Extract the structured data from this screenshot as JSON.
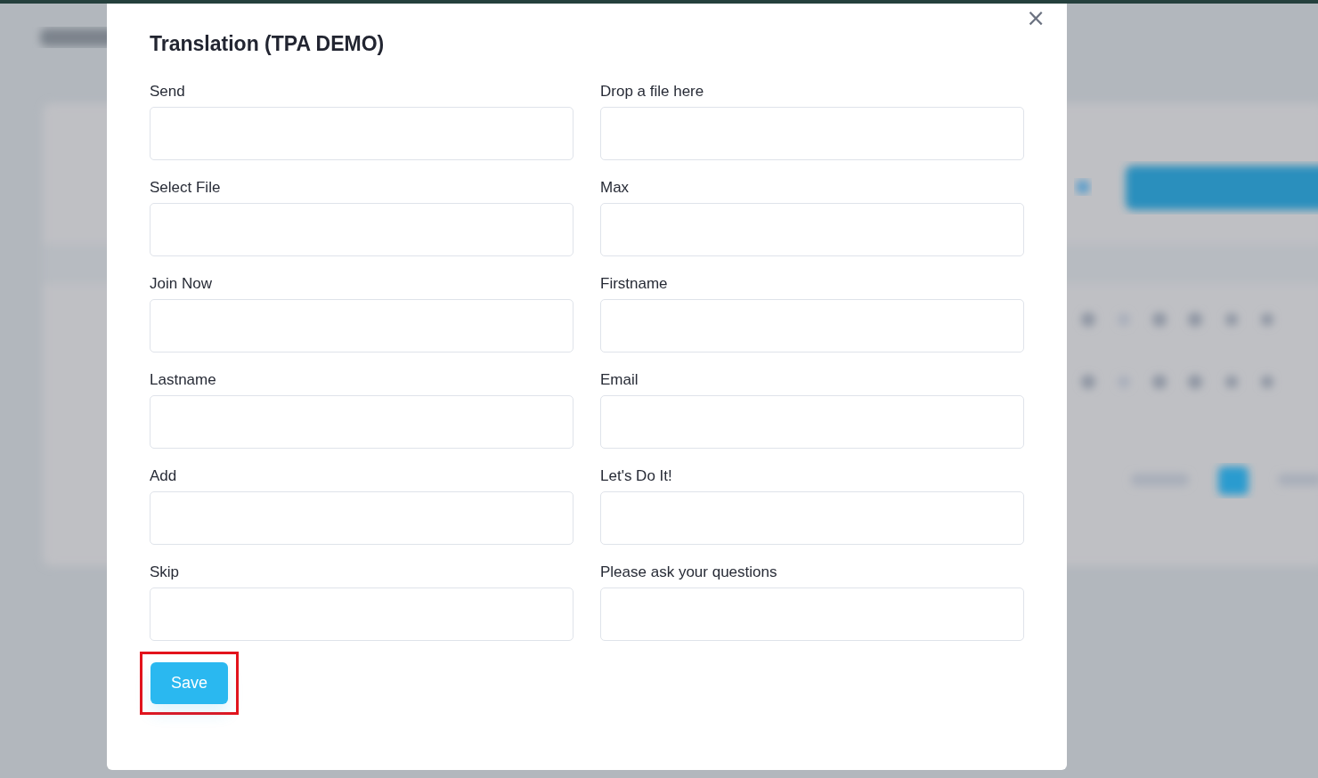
{
  "dialog": {
    "title": "Translation (TPA DEMO)",
    "close": "×",
    "fields": [
      {
        "label": "Send"
      },
      {
        "label": "Drop a file here"
      },
      {
        "label": "Select File"
      },
      {
        "label": "Max"
      },
      {
        "label": "Join Now"
      },
      {
        "label": "Firstname"
      },
      {
        "label": "Lastname"
      },
      {
        "label": "Email"
      },
      {
        "label": "Add"
      },
      {
        "label": "Let's Do It!"
      },
      {
        "label": "Skip"
      },
      {
        "label": "Please ask your questions"
      }
    ],
    "save_button": {
      "label": "Save",
      "highlighted": true
    }
  }
}
